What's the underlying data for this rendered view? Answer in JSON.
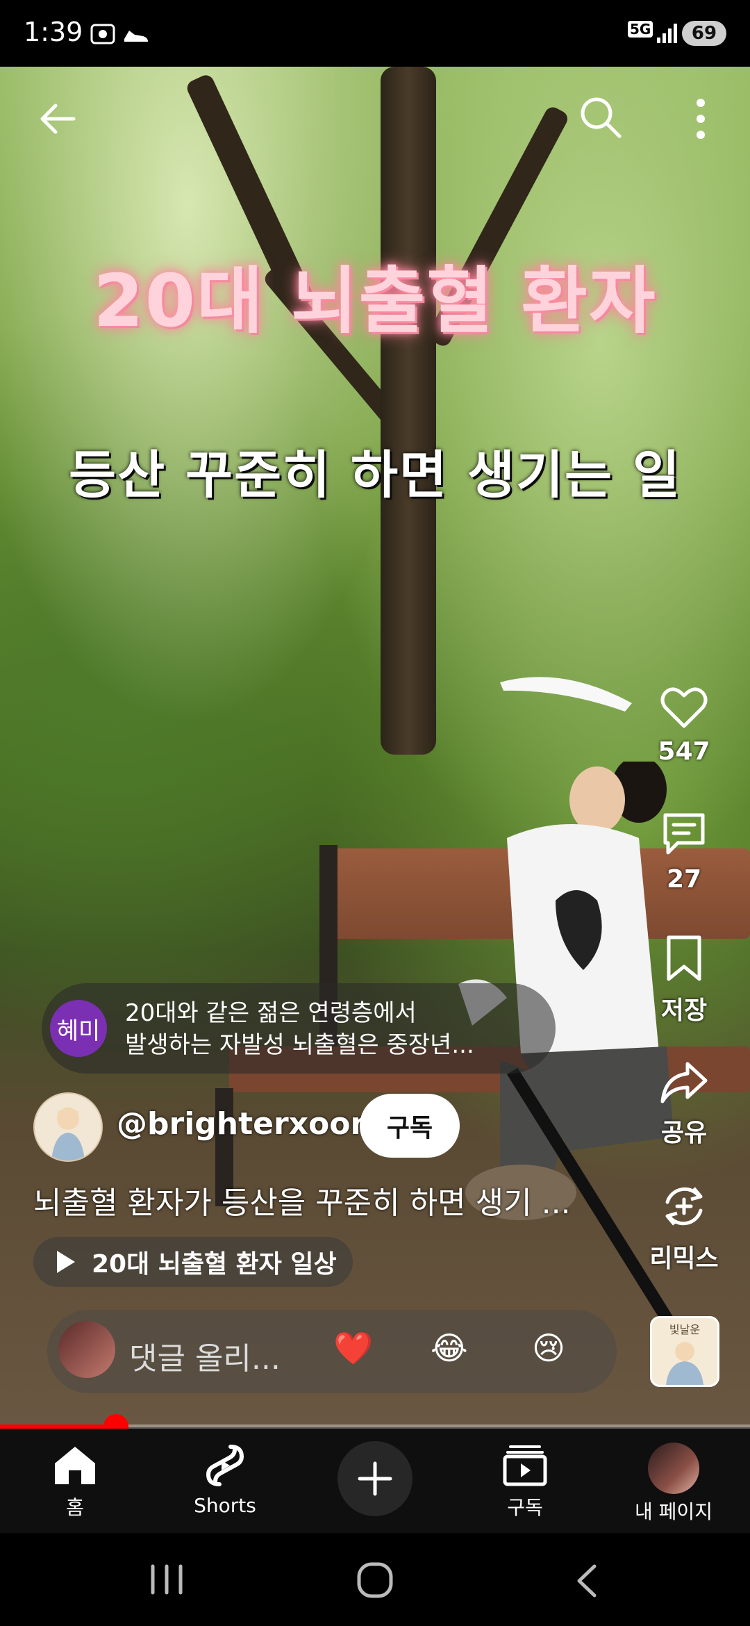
{
  "status_bar": {
    "time": "1:39",
    "network": "5G",
    "battery": "69"
  },
  "video": {
    "title_line1": "20대 뇌출혈 환자",
    "title_line2": "등산 꾸준히 하면 생기는 일"
  },
  "actions": {
    "like_count": "547",
    "comment_count": "27",
    "save_label": "저장",
    "share_label": "공유",
    "remix_label": "리믹스"
  },
  "top_comment": {
    "avatar_text": "혜미",
    "line1": "20대와 같은 젊은 연령층에서",
    "line2": "발생하는 자발성 뇌출혈은 중장년..."
  },
  "channel": {
    "handle": "@brighterxoon",
    "subscribe_label": "구독"
  },
  "description": "뇌출혈 환자가 등산을 꾸준히 하면 생기 ...",
  "playlist": "20대 뇌출혈 환자 일상",
  "comment_input": {
    "placeholder": "댓글 올리...",
    "emojis": [
      "❤️",
      "😂",
      "😢"
    ]
  },
  "remix_thumb_text": "빛날운",
  "progress": 0.155,
  "bottom_nav": {
    "home": "홈",
    "shorts": "Shorts",
    "subscriptions": "구독",
    "my_page": "내 페이지"
  }
}
